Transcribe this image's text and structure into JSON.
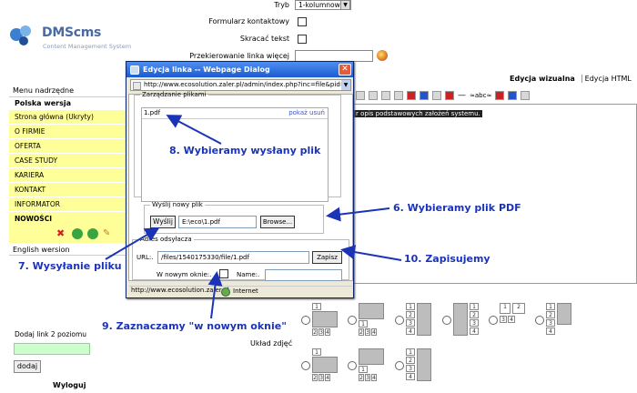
{
  "brand": {
    "name": "DMScms",
    "tagline": "Content Management System"
  },
  "sidebar": {
    "header": "Menu nadrzędne",
    "section": "Polska wersja",
    "items": [
      {
        "label": "Strona główna (Ukryty)"
      },
      {
        "label": "O FIRMIE"
      },
      {
        "label": "OFERTA"
      },
      {
        "label": "CASE STUDY"
      },
      {
        "label": "KARIERA"
      },
      {
        "label": "KONTAKT"
      },
      {
        "label": "INFORMATOR"
      },
      {
        "label": "NOWOŚCI"
      }
    ],
    "english": "English wersion",
    "add_level2_label": "Dodaj link 2 poziomu",
    "add_button": "dodaj",
    "logout": "Wyloguj"
  },
  "form": {
    "mode_label": "Tryb",
    "mode_value": "1-kolumnowy",
    "contact_form_label": "Formularz kontaktowy",
    "shorten_text_label": "Skracać tekst",
    "redirect_label": "Przekierowanie linka więcej",
    "tab_visual": "Edycja wizualna",
    "tab_html": "Edycja HTML",
    "abc_label": "≈abc≈",
    "editor_text": "r opis podstawowych założeń systemu.",
    "layout_label": "Układ zdjęć"
  },
  "thumb_labels": [
    "1",
    "2",
    "3",
    "4"
  ],
  "dialog": {
    "title": "Edycja linka -- Webpage Dialog",
    "url": "http://www.ecosolution.zaler.pl/admin/index.php?inc=file&pid=",
    "files_legend": "Zarządzanie plikami",
    "file_name": "1.pdf",
    "file_actions": "pokaż usuń",
    "upload_legend": "Wyślij nowy plik",
    "upload_button": "Wyślij",
    "upload_path": "E:\\eco\\1.pdf",
    "browse_button": "Browse...",
    "address_legend": "Adres odsyłacza",
    "url_label": "URL:.",
    "url_value": "/files/1540175330/file/1.pdf",
    "save_button": "Zapisz",
    "new_window_label": "W nowym oknie:.",
    "name_label": "Name:.",
    "status_url": "http://www.ecosolution.zaler.pl",
    "status_zone": "Internet"
  },
  "annotations": {
    "a8": "8. Wybieramy wysłany plik",
    "a6": "6. Wybieramy plik PDF",
    "a7": "7. Wysyłanie pliku",
    "a10": "10. Zapisujemy",
    "a9": "9. Zaznaczamy \"w nowym oknie\""
  },
  "colors": {
    "menu_item_bg": "#ffff99",
    "annotation": "#1b33b7",
    "dialog_title": "#1a5bd0",
    "link": "#3b55c5"
  }
}
